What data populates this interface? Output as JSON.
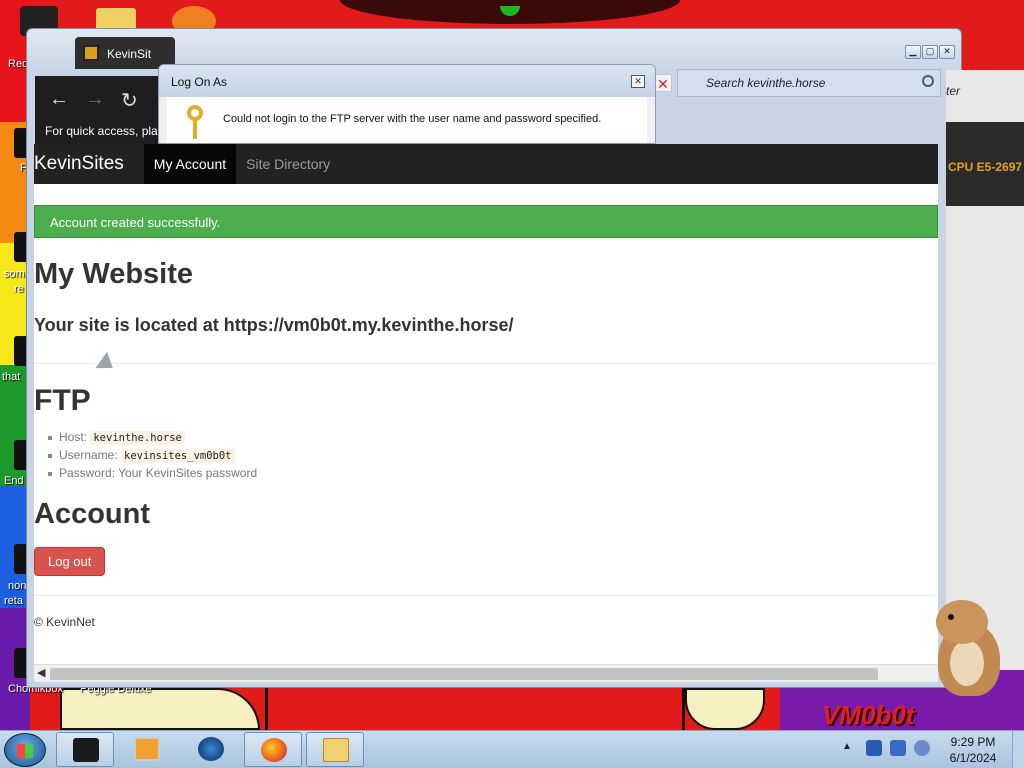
{
  "desktop": {
    "labels": [
      "Rec",
      "F",
      "som",
      "re",
      "that",
      "End",
      "non",
      "reta",
      "Chomikbox",
      "Peggle Deluxe"
    ],
    "wallpaper_text": "VM0b0t"
  },
  "browser": {
    "tab_title": "KevinSit",
    "quick_access_text": "For quick access, pla",
    "search_placeholder": "Search kevinthe.horse",
    "right_text": "ter",
    "cpu_text": "CPU E5-2697"
  },
  "dialog": {
    "title": "Log On As",
    "message": "Could not login to the FTP server with the user name and password specified."
  },
  "page": {
    "brand": "KevinSites",
    "nav": [
      {
        "label": "My Account",
        "active": true
      },
      {
        "label": "Site Directory",
        "active": false
      }
    ],
    "alert": "Account created successfully.",
    "website_heading": "My Website",
    "location_text": "Your site is located at https://vm0b0t.my.kevinthe.horse/",
    "ftp_heading": "FTP",
    "ftp": {
      "host_label": "Host:",
      "host_value": "kevinthe.horse",
      "username_label": "Username:",
      "username_value": "kevinsites_vm0b0t",
      "password_label": "Password:",
      "password_value": "Your KevinSites password"
    },
    "account_heading": "Account",
    "logout_label": "Log out",
    "footer": "© KevinNet"
  },
  "taskbar": {
    "time": "9:29 PM",
    "date": "6/1/2024"
  },
  "colors": {
    "navbar": "#222222",
    "success": "#4cae4c",
    "danger": "#d9534f"
  }
}
